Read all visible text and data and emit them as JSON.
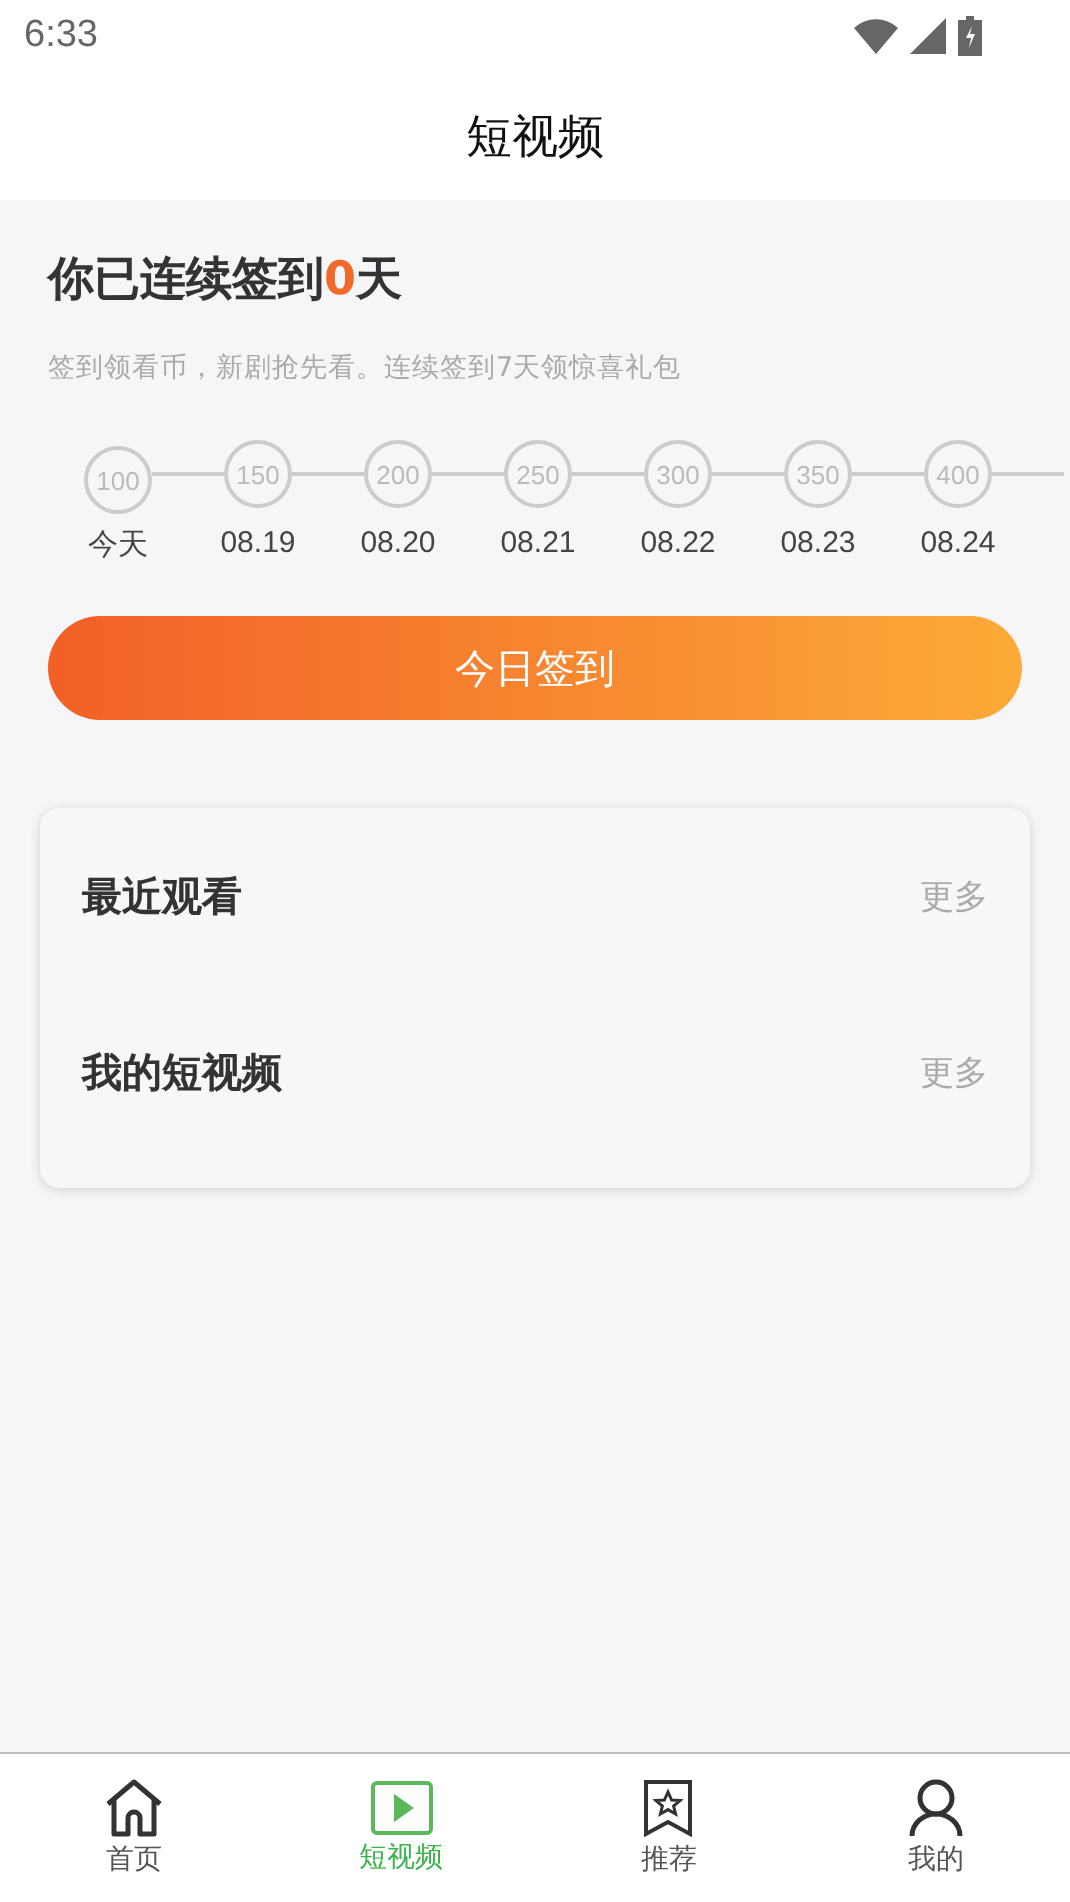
{
  "status_bar": {
    "time": "6:33"
  },
  "header": {
    "title": "短视频"
  },
  "checkin": {
    "prefix": "你已连续签到",
    "count": "0",
    "suffix": "天",
    "subtitle": "签到领看币，新剧抢先看。连续签到7天领惊喜礼包",
    "steps": [
      {
        "reward": "100",
        "date": "今天"
      },
      {
        "reward": "150",
        "date": "08.19"
      },
      {
        "reward": "200",
        "date": "08.20"
      },
      {
        "reward": "250",
        "date": "08.21"
      },
      {
        "reward": "300",
        "date": "08.22"
      },
      {
        "reward": "350",
        "date": "08.23"
      },
      {
        "reward": "400",
        "date": "08.24"
      }
    ],
    "button": "今日签到"
  },
  "sections": [
    {
      "title": "最近观看",
      "more": "更多"
    },
    {
      "title": "我的短视频",
      "more": "更多"
    }
  ],
  "tabs": [
    {
      "label": "首页",
      "kind": "home",
      "selected": false
    },
    {
      "label": "短视频",
      "kind": "play",
      "selected": true
    },
    {
      "label": "推荐",
      "kind": "bookmark",
      "selected": false
    },
    {
      "label": "我的",
      "kind": "user",
      "selected": false
    }
  ]
}
